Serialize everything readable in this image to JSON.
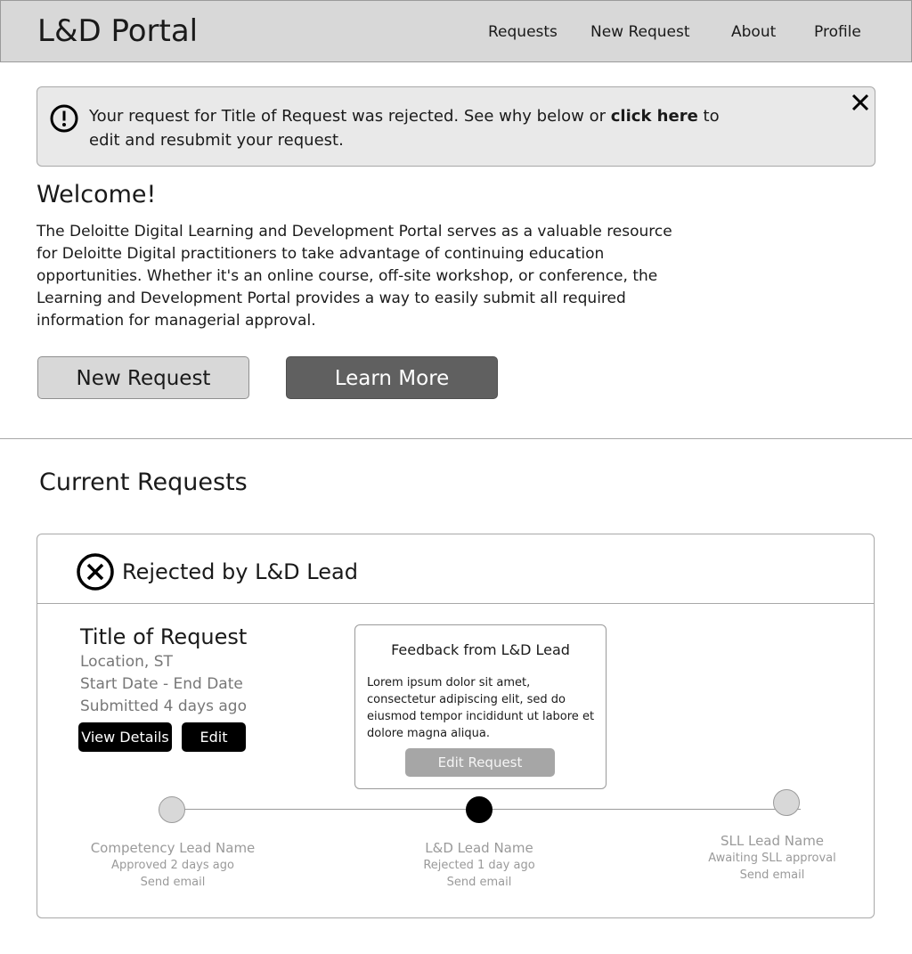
{
  "header": {
    "app_title": "L&D Portal",
    "nav": [
      "Requests",
      "New Request",
      "About",
      "Profile"
    ]
  },
  "alert": {
    "text_before": "Your request for Title of Request was rejected. See why below or ",
    "link_text": "click here",
    "text_after": " to edit and resubmit your request.",
    "icon": "exclamation-circle-icon",
    "close_icon": "close-icon"
  },
  "welcome": {
    "title": "Welcome!",
    "body": "The Deloitte Digital Learning and Development Portal serves as a valuable resource for Deloitte Digital practitioners to take advantage of continuing education opportunities. Whether it's an online course, off-site workshop, or conference, the Learning and Development Portal provides a way to easily submit all required information for managerial approval.",
    "new_request_label": "New Request",
    "learn_more_label": "Learn More"
  },
  "current_requests": {
    "title": "Current Requests",
    "card": {
      "status": "Rejected by L&D Lead",
      "status_icon": "x-circle-icon",
      "request_title": "Title of Request",
      "location": "Location, ST",
      "dates": "Start Date - End Date",
      "submitted": "Submitted 4 days ago",
      "view_details_label": "View Details",
      "edit_label": "Edit",
      "feedback": {
        "title": "Feedback from L&D Lead",
        "body": "Lorem ipsum dolor sit amet, consectetur adipiscing elit, sed do eiusmod tempor incididunt ut labore et dolore magna aliqua.",
        "button_label": "Edit Request"
      },
      "timeline": [
        {
          "name": "Competency Lead Name",
          "status": "Approved 2 days ago",
          "email": "Send email",
          "state": "complete"
        },
        {
          "name": "L&D Lead Name",
          "status": "Rejected 1 day ago",
          "email": "Send email",
          "state": "current"
        },
        {
          "name": "SLL Lead Name",
          "status": "Awaiting SLL approval",
          "email": "Send email",
          "state": "pending"
        }
      ]
    }
  },
  "colors": {
    "header_bg": "#d8d8d8",
    "alert_bg": "#e9e9e9",
    "primary_dark_button": "#606060",
    "small_button": "#000000",
    "disabled_button": "#a6a6a6"
  }
}
